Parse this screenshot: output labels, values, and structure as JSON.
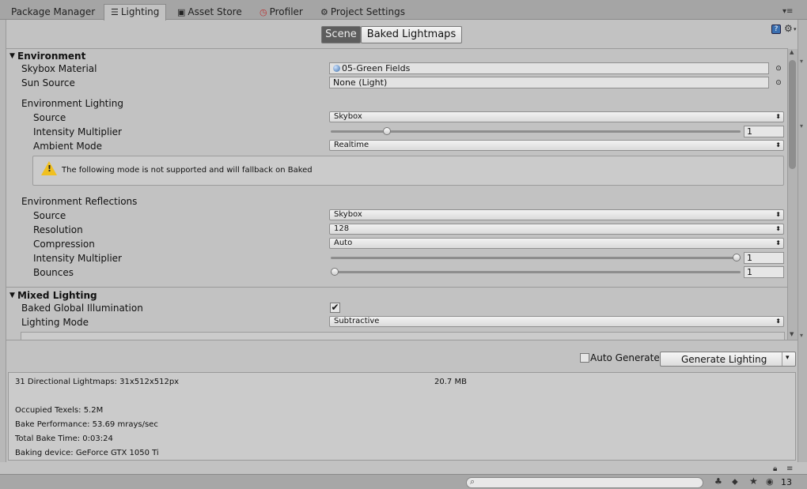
{
  "tabs": [
    {
      "label": "Package Manager",
      "icon": ""
    },
    {
      "label": "Lighting",
      "icon": "lighting-icon"
    },
    {
      "label": "Asset Store",
      "icon": "asset-store-icon"
    },
    {
      "label": "Profiler",
      "icon": "profiler-icon"
    },
    {
      "label": "Project Settings",
      "icon": "gear-icon"
    }
  ],
  "toolbar": {
    "scene_label": "Scene",
    "baked_label": "Baked Lightmaps"
  },
  "environment": {
    "header": "Environment",
    "skybox_label": "Skybox Material",
    "skybox_value": "05-Green Fields",
    "sun_label": "Sun Source",
    "sun_value": "None (Light)",
    "env_lighting_header": "Environment Lighting",
    "source_label": "Source",
    "source_value": "Skybox",
    "intensity_label": "Intensity Multiplier",
    "intensity_value": "1",
    "intensity_fraction": 0.13,
    "ambient_label": "Ambient Mode",
    "ambient_value": "Realtime",
    "warning_text": "The following mode is not supported and will fallback on Baked",
    "reflections_header": "Environment Reflections",
    "refl_source_label": "Source",
    "refl_source_value": "Skybox",
    "resolution_label": "Resolution",
    "resolution_value": "128",
    "compression_label": "Compression",
    "compression_value": "Auto",
    "refl_intensity_label": "Intensity Multiplier",
    "refl_intensity_value": "1",
    "refl_intensity_fraction": 1.0,
    "bounces_label": "Bounces",
    "bounces_value": "1",
    "bounces_fraction": 0.0
  },
  "mixed": {
    "header": "Mixed Lighting",
    "baked_gi_label": "Baked Global Illumination",
    "baked_gi_checked": true,
    "mode_label": "Lighting Mode",
    "mode_value": "Subtractive"
  },
  "generate": {
    "auto_label": "Auto Generate",
    "auto_checked": false,
    "button_label": "Generate Lighting"
  },
  "stats": {
    "lightmaps": "31 Directional Lightmaps: 31x512x512px",
    "size": "20.7 MB",
    "texels": "Occupied Texels: 5.2M",
    "performance": "Bake Performance: 53.69 mrays/sec",
    "bake_time": "Total Bake Time: 0:03:24",
    "device": "Baking device: GeForce GTX 1050 Ti"
  },
  "statusbar": {
    "hidden_count": "13"
  }
}
